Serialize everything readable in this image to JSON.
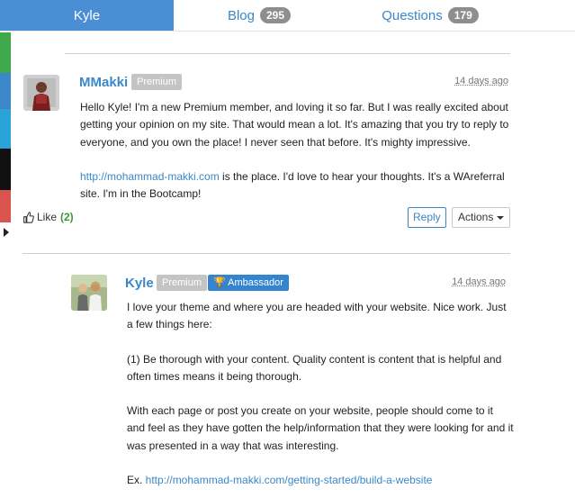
{
  "tabs": {
    "active": "Kyle",
    "blog_label": "Blog",
    "blog_count": "295",
    "questions_label": "Questions",
    "questions_count": "179"
  },
  "side_strip": {
    "colors": [
      "#ffffff",
      "#3ea84a",
      "#3b87c8",
      "#2aa3d8",
      "#111111",
      "#d9534f"
    ]
  },
  "comment": {
    "username": "MMakki",
    "badge": "Premium",
    "timestamp": "14 days ago",
    "paragraph1": "Hello Kyle! I'm a new Premium member, and loving it so far. But I was really excited about getting your opinion on my site. That would mean a lot. It's amazing that you try to reply to everyone, and you own the place! I never seen that before. It's mighty impressive.",
    "link": "http://mohammad-makki.com",
    "paragraph2_rest": " is the place. I'd love to hear your thoughts. It's a WAreferral site. I'm in the Bootcamp!",
    "like_label": "Like",
    "like_count": "(2)",
    "reply_label": "Reply",
    "actions_label": "Actions"
  },
  "reply": {
    "username": "Kyle",
    "badge": "Premium",
    "ambassador": "Ambassador",
    "timestamp": "14 days ago",
    "p1": "I love your theme and where you are headed with your website. Nice work. Just a few things here:",
    "p2": "(1) Be thorough with your content. Quality content is content that is helpful and often times means it being thorough.",
    "p3": "With each page or post you create on your website, people should come to it and feel as they have gotten the help/information that they were looking for and it was presented in a way that was interesting.",
    "ex_label": "Ex. ",
    "ex_link": "http://mohammad-makki.com/getting-started/build-a-website"
  },
  "icons": {
    "like": "thumbs-up-icon",
    "trophy": "trophy-icon",
    "caret": "caret-down-icon",
    "expand": "expand-arrow-icon"
  }
}
